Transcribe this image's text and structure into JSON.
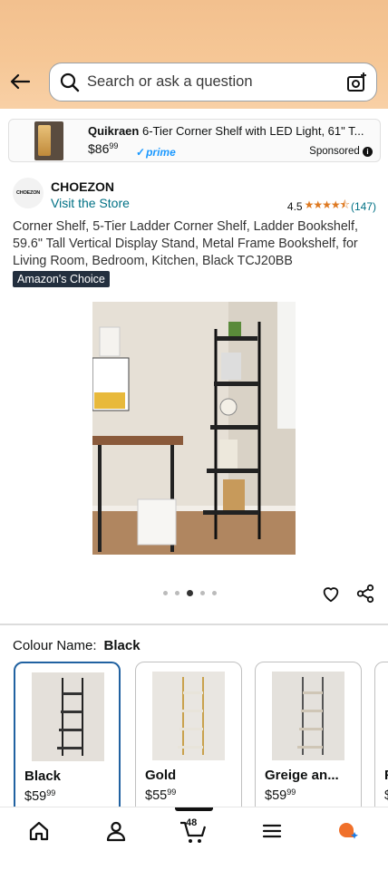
{
  "header": {
    "search_placeholder": "Search or ask a question"
  },
  "sponsored_ad": {
    "brand": "Quikraen",
    "title_rest": " 6-Tier Corner Shelf with LED Light, 61\" T...",
    "price_whole": "$86",
    "price_fraction": "99",
    "prime_label": "prime",
    "sponsored_label": "Sponsored"
  },
  "product": {
    "brand_logo_text": "CHOEZON",
    "brand": "CHOEZON",
    "store_link": "Visit the Store",
    "rating": "4.5",
    "rating_value": 4.5,
    "review_count": "(147)",
    "title": "Corner Shelf, 5-Tier Ladder Corner Shelf, Ladder Bookshelf, 59.6\" Tall Vertical Display Stand, Metal Frame Bookshelf, for Living Room, Bedroom, Kitchen, Black TCJ20BB",
    "badge": "Amazon's Choice",
    "image_count": 5,
    "active_image_index": 2
  },
  "colour": {
    "label": "Colour Name:",
    "selected": "Black",
    "options": [
      {
        "name": "Black",
        "price_whole": "$59",
        "price_fraction": "99"
      },
      {
        "name": "Gold",
        "price_whole": "$55",
        "price_fraction": "99"
      },
      {
        "name": "Greige an...",
        "price_whole": "$59",
        "price_fraction": "99"
      },
      {
        "name": "F",
        "price_whole": "$",
        "price_fraction": ""
      }
    ]
  },
  "bottom_nav": {
    "items": [
      "home-icon",
      "account-icon",
      "cart-icon",
      "menu-icon",
      "rufus-icon"
    ],
    "cart_count": "48"
  },
  "colors": {
    "header_bg": "#f6c796",
    "link": "#007185",
    "star": "#de7921",
    "selected_border": "#2162a1",
    "badge_bg": "#232f3e"
  }
}
